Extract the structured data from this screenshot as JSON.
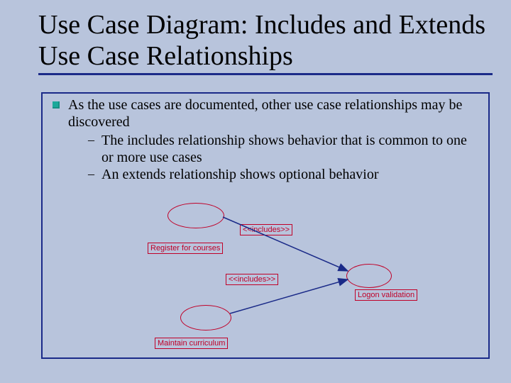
{
  "title": "Use Case Diagram: Includes and Extends Use Case Relationships",
  "body": {
    "main": "As the use cases are documented, other use case relationships may be discovered",
    "sub1": "The includes  relationship shows behavior that is common to one or more use cases",
    "sub2": "An extends relationship shows optional behavior"
  },
  "diagram": {
    "register": "Register for courses",
    "maintain": "Maintain curriculum",
    "logon": "Logon validation",
    "includes1": "<<includes>>",
    "includes2": "<<includes>>"
  }
}
